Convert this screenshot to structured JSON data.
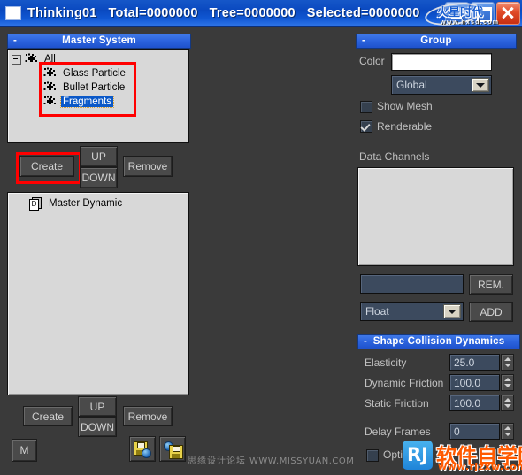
{
  "titlebar": {
    "app_name": "Thinking01",
    "total": "Total=0000000",
    "tree": "Tree=0000000",
    "selected": "Selected=0000000",
    "minimize_label": "minimize",
    "maximize_label": "maximize",
    "close_label": "close"
  },
  "watermarks": {
    "hxsd_cn": "火星时代",
    "hxsd_url": "www.hxsd.com",
    "missyuan_cn": "思缘设计论坛",
    "missyuan_url": "WWW.MISSYUAN.COM",
    "rjzxw_badge": "RJ",
    "rjzxw_cn": "软件自学网",
    "rjzxw_url": "www.rjzxw.com"
  },
  "master_system": {
    "title": "Master System",
    "collapse_glyph": "-",
    "tree": [
      {
        "label": "All",
        "depth": 0,
        "icon": "particle-icon",
        "selected": false,
        "expander": true
      },
      {
        "label": "Glass Particle",
        "depth": 1,
        "icon": "particle-icon",
        "selected": false,
        "expander": false
      },
      {
        "label": "Bullet Particle",
        "depth": 1,
        "icon": "particle-icon",
        "selected": false,
        "expander": false
      },
      {
        "label": "Fragments",
        "depth": 1,
        "icon": "particle-icon",
        "selected": true,
        "expander": false
      }
    ],
    "buttons": {
      "create": "Create",
      "up": "UP",
      "down": "DOWN",
      "remove": "Remove"
    }
  },
  "master_dynamic": {
    "tree": [
      {
        "label": "Master Dynamic",
        "icon": "document-icon",
        "selected": false
      }
    ],
    "buttons": {
      "create": "Create",
      "up": "UP",
      "down": "DOWN",
      "remove": "Remove",
      "m": "M",
      "save": "save-icon",
      "load": "load-icon"
    }
  },
  "group": {
    "title": "Group",
    "collapse_glyph": "-",
    "color_label": "Color",
    "color_value": "#ffffff",
    "scope_value": "Global",
    "show_mesh_label": "Show Mesh",
    "show_mesh_checked": false,
    "renderable_label": "Renderable",
    "renderable_checked": true,
    "data_channels_label": "Data Channels",
    "data_channels_items": [],
    "channel_name_value": "",
    "remove_label": "REM.",
    "type_value": "Float",
    "add_label": "ADD"
  },
  "shape_collision": {
    "title": "Shape Collision Dynamics",
    "collapse_glyph": "-",
    "rows": [
      {
        "label": "Elasticity",
        "value": "25.0"
      },
      {
        "label": "Dynamic Friction",
        "value": "100.0"
      },
      {
        "label": "Static Friction",
        "value": "100.0"
      }
    ],
    "delay_label": "Delay Frames",
    "delay_value": "0",
    "optimize_label": "Optimize",
    "optimize_checked": false
  },
  "colors": {
    "window_bg": "#3a3a3a",
    "rollout_blue": "#2b62dc",
    "titlebar_blue": "#0f56d2",
    "listbox_bg": "#d8d8d8",
    "field_bg": "#3c4a5e",
    "annotation_red": "#ff0000",
    "selection_blue": "#0a58c8"
  }
}
